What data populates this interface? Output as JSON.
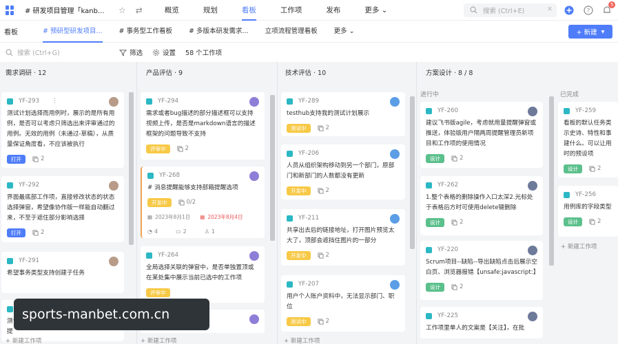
{
  "topbar": {
    "project_title": "# 研发项目管理「kanb...",
    "nav": [
      "概览",
      "规划",
      "看板",
      "工作项",
      "发布",
      "更多"
    ],
    "search_placeholder": "搜索 (Ctrl+E)",
    "notification_count": "5"
  },
  "subbar": {
    "view_label": "看板",
    "tabs": [
      "# 预研型研发项目...",
      "# 事务型工作看板",
      "# 多版本研发需求...",
      "立项流程管理看板",
      "更多"
    ],
    "new_button": "+ 新建"
  },
  "filterbar": {
    "search_placeholder": "搜索 (Ctrl+G)",
    "filter": "筛选",
    "settings": "设置",
    "count": "58 个工作项"
  },
  "columns": [
    {
      "title": "需求调研 · 12",
      "cards": [
        {
          "id": "YF-293",
          "text": "测试计划选择而用例时，展示的是所有用例，是否可以考虑只筛选出来评审通过的用例。无效的用例（未通过-草稿），从质量保证角度看，不应该被执行",
          "tag": "打开",
          "sub": "2"
        },
        {
          "id": "YF-292",
          "text": "界面最底部工作项，直接修改状态的状态选择弹窗，希望像协作版一样能自动翻过来，不至于遮住部分影响选择",
          "tag": "打开",
          "sub": "2"
        },
        {
          "id": "YF-291",
          "text": "希望事务类型支持创建子任务"
        },
        {
          "id": "",
          "text": "测试用例在N个步骤可以新建多个模板以提"
        }
      ],
      "add_new": "+ 新建工作项"
    },
    {
      "title": "产品评估 · 9",
      "cards": [
        {
          "id": "YF-294",
          "text": "需求或者bug描述的部分描述框可以支持视频上传，是否是markdown语言的描述框架的问题导致不支持",
          "tag": "评审中",
          "sub": "2"
        },
        {
          "id": "YF-268",
          "text": "# 消息提醒能够支持部箱提醒选项",
          "tag": "开发中",
          "sub": "0/2",
          "start": "2023年8月1日",
          "due": "2023年8月4日",
          "m1": "4",
          "m2": "2",
          "m3": "1"
        },
        {
          "id": "YF-264",
          "text": "全局选择关联的弹窗中，是否单独置顶或在某处集中展示当前已选中的工作项",
          "tag": "评审中"
        },
        {
          "id": "",
          "text": ""
        }
      ],
      "add_new": "+ 新建工作项"
    },
    {
      "title": "技术评估 · 10",
      "cards": [
        {
          "id": "YF-289",
          "text": "testhub支持我的测试计划展示",
          "tag": "测试中",
          "sub": "2"
        },
        {
          "id": "YF-206",
          "text": "人员从组织架构移动到另一个部门，原部门和新部门的人数都没有更新",
          "tag": "开发中",
          "sub": "2"
        },
        {
          "id": "YF-211",
          "text": "共享出去后的链接地址，打开图片预览太大了，顶部会遮挡住图片的一部分",
          "tag": "开发中",
          "sub": "2"
        },
        {
          "id": "YF-207",
          "text": "用户个人账户资料中，无法显示部门、职位",
          "tag": "测试中",
          "sub": "2"
        }
      ],
      "add_new": "+ 新建工作项"
    },
    {
      "title": "方案设计 · 8 / 8",
      "group_in_progress": "进行中",
      "group_done": "已完成",
      "cards": [
        {
          "id": "YF-260",
          "text": "建议飞书版agile，考虑就用量提醒弹窗或推送，体验版用户隔两周提醒管理员新项目和工作项的使用情况",
          "tag": "设计",
          "sub": "2"
        },
        {
          "id": "YF-262",
          "text": "1.整个表格的删除操作入口太深2.光标处于表格后方时可使用delete键删除",
          "tag": "设计",
          "sub": "2"
        },
        {
          "id": "YF-220",
          "text": "Scrum项目--缺陷--导出缺陷点击后展示空白页、浏览器报错【unsafe:javascript:】",
          "tag": "设计",
          "sub": "2"
        },
        {
          "id": "YF-225",
          "text": "工作项里单人的文案是【关注】，在批"
        }
      ],
      "done_cards": [
        {
          "id": "YF-259",
          "text": "看板的默认任务类示史诗、特性和事建什么。可以让用时的预设项",
          "tag": "设计",
          "sub": "2"
        },
        {
          "id": "YF-256",
          "text": "用例库的字段类型",
          "tag": "设计",
          "sub": "2"
        }
      ],
      "add_new": "+ 新建工作项"
    }
  ],
  "watermark": "sports-manbet.com.cn",
  "colors": {
    "accent": "#4f7df9",
    "tag_yellow": "#f7c946",
    "tag_green": "#5cc08c",
    "icon_teal": "#2bb8c4"
  }
}
